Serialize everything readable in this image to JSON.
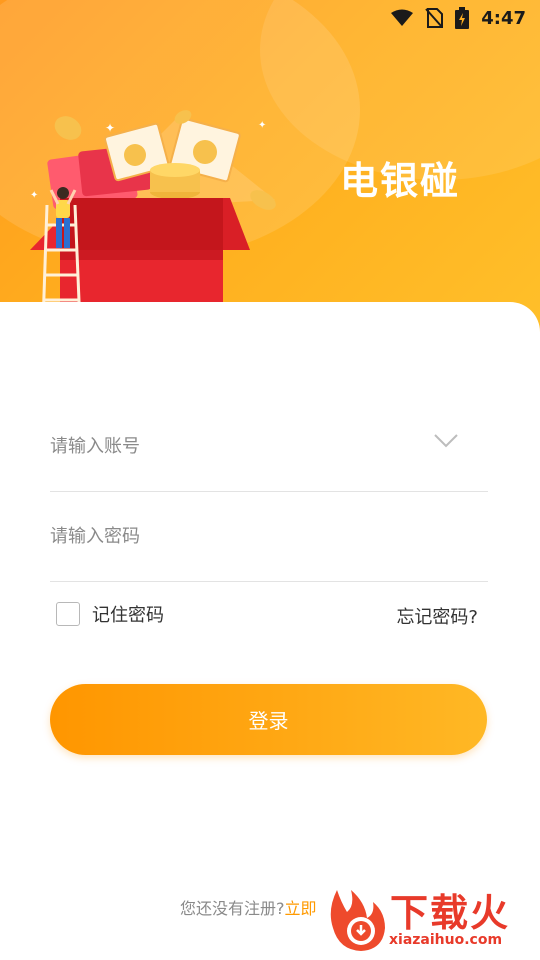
{
  "status_bar": {
    "time": "4:47"
  },
  "app": {
    "title": "电银碰"
  },
  "login": {
    "account_placeholder": "请输入账号",
    "password_placeholder": "请输入密码",
    "remember_label": "记住密码",
    "forgot_label": "忘记密码?",
    "login_button": "登录",
    "register_prompt": "您还没有注册?",
    "register_link": "立即"
  },
  "watermark": {
    "brand": "下载火",
    "domain": "xiazaihuo.com"
  },
  "colors": {
    "accent": "#ff9a00",
    "hero_start": "#ff9a1f",
    "hero_end": "#ffc02a",
    "watermark": "#e83a2a"
  },
  "icons": [
    "wifi-icon",
    "no-sim-icon",
    "battery-icon",
    "chevron-down-icon",
    "gift-box-illustration"
  ]
}
